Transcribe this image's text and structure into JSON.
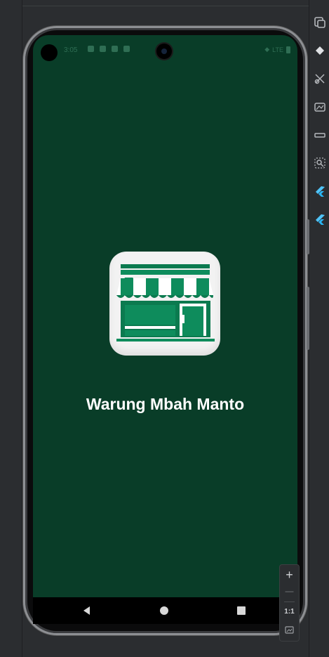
{
  "status_bar": {
    "time": "3:05",
    "network": "LTE"
  },
  "app": {
    "name": "Warung Mbah Manto",
    "background_color": "#093d28",
    "icon": "storefront-icon"
  },
  "navigation": {
    "back": "back-triangle-icon",
    "home": "home-circle-icon",
    "recents": "recents-square-icon"
  },
  "zoom_controls": {
    "zoom_in": "+",
    "zoom_out": "—",
    "actual_size": "1:1"
  },
  "toolbar_icons": [
    "device-manager-icon",
    "diamond-icon",
    "scissors-icon",
    "screenshot-icon",
    "minus-icon",
    "search-icon",
    "flutter-icon",
    "flutter-icon"
  ]
}
